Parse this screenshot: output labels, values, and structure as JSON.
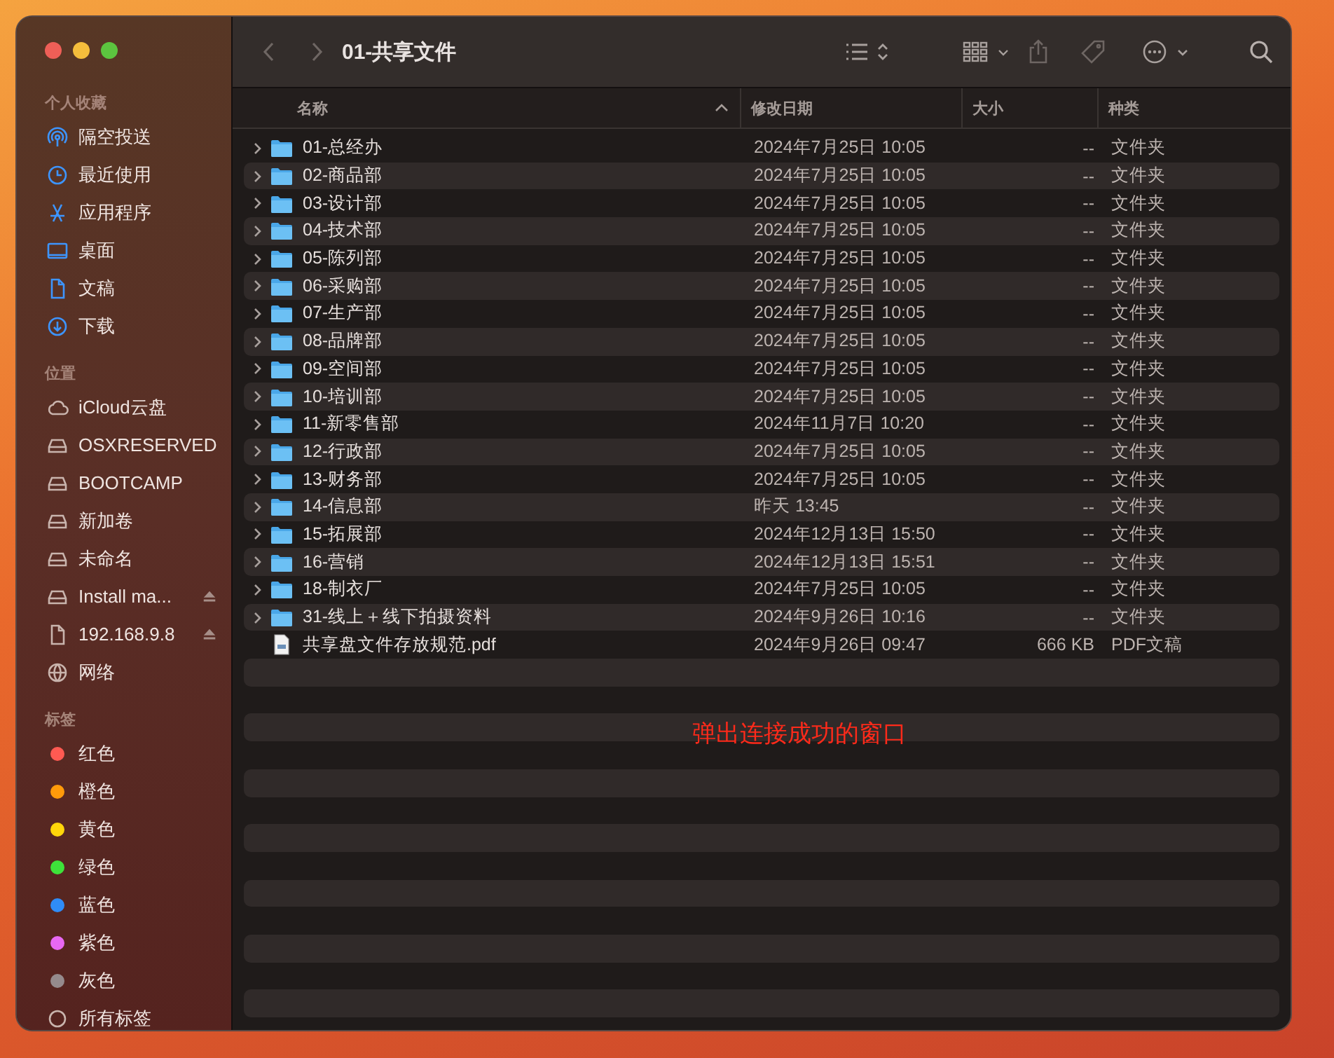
{
  "window": {
    "title": "01-共享文件"
  },
  "sidebar": {
    "sections": [
      {
        "label": "个人收藏",
        "items": [
          {
            "label": "隔空投送",
            "kind": "airdrop"
          },
          {
            "label": "最近使用",
            "kind": "recent"
          },
          {
            "label": "应用程序",
            "kind": "apps"
          },
          {
            "label": "桌面",
            "kind": "desktop"
          },
          {
            "label": "文稿",
            "kind": "document"
          },
          {
            "label": "下载",
            "kind": "download"
          }
        ]
      },
      {
        "label": "位置",
        "items": [
          {
            "label": "iCloud云盘",
            "kind": "cloud",
            "eject": false
          },
          {
            "label": "OSXRESERVED",
            "kind": "drive",
            "eject": false
          },
          {
            "label": "BOOTCAMP",
            "kind": "drive",
            "eject": false
          },
          {
            "label": "新加卷",
            "kind": "drive",
            "eject": false
          },
          {
            "label": "未命名",
            "kind": "drive",
            "eject": false
          },
          {
            "label": "Install ma...",
            "kind": "drive",
            "eject": true
          },
          {
            "label": "192.168.9.8",
            "kind": "file",
            "eject": true
          },
          {
            "label": "网络",
            "kind": "network",
            "eject": false
          }
        ]
      },
      {
        "label": "标签",
        "items": [
          {
            "label": "红色",
            "kind": "tag",
            "color": "#ff5a52"
          },
          {
            "label": "橙色",
            "kind": "tag",
            "color": "#ff9a0a"
          },
          {
            "label": "黄色",
            "kind": "tag",
            "color": "#ffd60a"
          },
          {
            "label": "绿色",
            "kind": "tag",
            "color": "#3ee33a"
          },
          {
            "label": "蓝色",
            "kind": "tag",
            "color": "#2f8cf7"
          },
          {
            "label": "紫色",
            "kind": "tag",
            "color": "#e868f2"
          },
          {
            "label": "灰色",
            "kind": "tag",
            "color": "#958a8c"
          },
          {
            "label": "所有标签",
            "kind": "alltags"
          }
        ]
      }
    ]
  },
  "table": {
    "columns": [
      {
        "label": "名称",
        "sorted": true
      },
      {
        "label": "修改日期",
        "sorted": false
      },
      {
        "label": "大小",
        "sorted": false
      },
      {
        "label": "种类",
        "sorted": false
      }
    ],
    "rows": [
      {
        "name": "01-总经办",
        "date": "2024年7月25日 10:05",
        "size": "--",
        "kind_text": "文件夹",
        "kind": "folder"
      },
      {
        "name": "02-商品部",
        "date": "2024年7月25日 10:05",
        "size": "--",
        "kind_text": "文件夹",
        "kind": "folder"
      },
      {
        "name": "03-设计部",
        "date": "2024年7月25日 10:05",
        "size": "--",
        "kind_text": "文件夹",
        "kind": "folder"
      },
      {
        "name": "04-技术部",
        "date": "2024年7月25日 10:05",
        "size": "--",
        "kind_text": "文件夹",
        "kind": "folder"
      },
      {
        "name": "05-陈列部",
        "date": "2024年7月25日 10:05",
        "size": "--",
        "kind_text": "文件夹",
        "kind": "folder"
      },
      {
        "name": "06-采购部",
        "date": "2024年7月25日 10:05",
        "size": "--",
        "kind_text": "文件夹",
        "kind": "folder"
      },
      {
        "name": "07-生产部",
        "date": "2024年7月25日 10:05",
        "size": "--",
        "kind_text": "文件夹",
        "kind": "folder"
      },
      {
        "name": "08-品牌部",
        "date": "2024年7月25日 10:05",
        "size": "--",
        "kind_text": "文件夹",
        "kind": "folder"
      },
      {
        "name": "09-空间部",
        "date": "2024年7月25日 10:05",
        "size": "--",
        "kind_text": "文件夹",
        "kind": "folder"
      },
      {
        "name": "10-培训部",
        "date": "2024年7月25日 10:05",
        "size": "--",
        "kind_text": "文件夹",
        "kind": "folder"
      },
      {
        "name": "11-新零售部",
        "date": "2024年11月7日 10:20",
        "size": "--",
        "kind_text": "文件夹",
        "kind": "folder"
      },
      {
        "name": "12-行政部",
        "date": "2024年7月25日 10:05",
        "size": "--",
        "kind_text": "文件夹",
        "kind": "folder"
      },
      {
        "name": "13-财务部",
        "date": "2024年7月25日 10:05",
        "size": "--",
        "kind_text": "文件夹",
        "kind": "folder"
      },
      {
        "name": "14-信息部",
        "date": "昨天 13:45",
        "size": "--",
        "kind_text": "文件夹",
        "kind": "folder"
      },
      {
        "name": "15-拓展部",
        "date": "2024年12月13日 15:50",
        "size": "--",
        "kind_text": "文件夹",
        "kind": "folder"
      },
      {
        "name": "16-营销",
        "date": "2024年12月13日 15:51",
        "size": "--",
        "kind_text": "文件夹",
        "kind": "folder"
      },
      {
        "name": "18-制衣厂",
        "date": "2024年7月25日 10:05",
        "size": "--",
        "kind_text": "文件夹",
        "kind": "folder"
      },
      {
        "name": "31-线上＋线下拍摄资料",
        "date": "2024年9月26日 10:16",
        "size": "--",
        "kind_text": "文件夹",
        "kind": "folder"
      },
      {
        "name": "共享盘文件存放规范.pdf",
        "date": "2024年9月26日 09:47",
        "size": "666 KB",
        "kind_text": "PDF文稿",
        "kind": "pdf"
      }
    ]
  },
  "annotation": {
    "text": "弹出连接成功的窗口",
    "color": "#ff2a1a"
  }
}
